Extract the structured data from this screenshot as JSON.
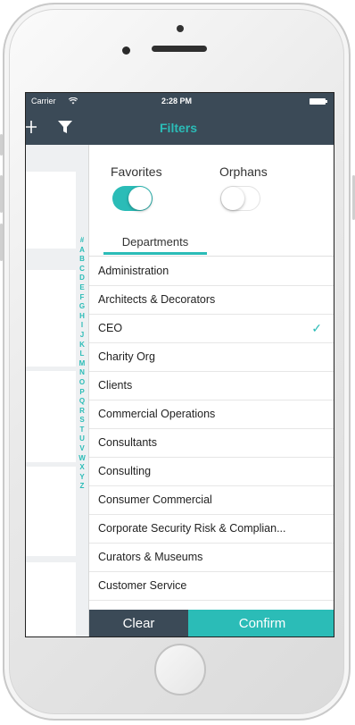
{
  "status": {
    "carrier": "Carrier",
    "time": "2:28 PM"
  },
  "nav": {
    "title": "Filters",
    "add_icon": "plus-icon",
    "filter_icon": "funnel-icon"
  },
  "toggles": {
    "favorites": {
      "label": "Favorites",
      "on": true
    },
    "orphans": {
      "label": "Orphans",
      "on": false
    }
  },
  "tab": {
    "label": "Departments"
  },
  "index_letters": [
    "#",
    "A",
    "B",
    "C",
    "D",
    "E",
    "F",
    "G",
    "H",
    "I",
    "J",
    "K",
    "L",
    "M",
    "N",
    "O",
    "P",
    "Q",
    "R",
    "S",
    "T",
    "U",
    "V",
    "W",
    "X",
    "Y",
    "Z"
  ],
  "departments": [
    {
      "label": "Administration",
      "selected": false
    },
    {
      "label": "Architects & Decorators",
      "selected": false
    },
    {
      "label": "CEO",
      "selected": true
    },
    {
      "label": "Charity Org",
      "selected": false
    },
    {
      "label": "Clients",
      "selected": false
    },
    {
      "label": "Commercial Operations",
      "selected": false
    },
    {
      "label": "Consultants",
      "selected": false
    },
    {
      "label": "Consulting",
      "selected": false
    },
    {
      "label": "Consumer Commercial",
      "selected": false
    },
    {
      "label": "Corporate Security Risk & Complian...",
      "selected": false
    },
    {
      "label": "Curators & Museums",
      "selected": false
    },
    {
      "label": "Customer Service",
      "selected": false
    }
  ],
  "footer": {
    "clear_label": "Clear",
    "confirm_label": "Confirm"
  },
  "colors": {
    "nav": "#3b4a57",
    "accent": "#2bbcb7",
    "check": "#2bbcb7"
  }
}
